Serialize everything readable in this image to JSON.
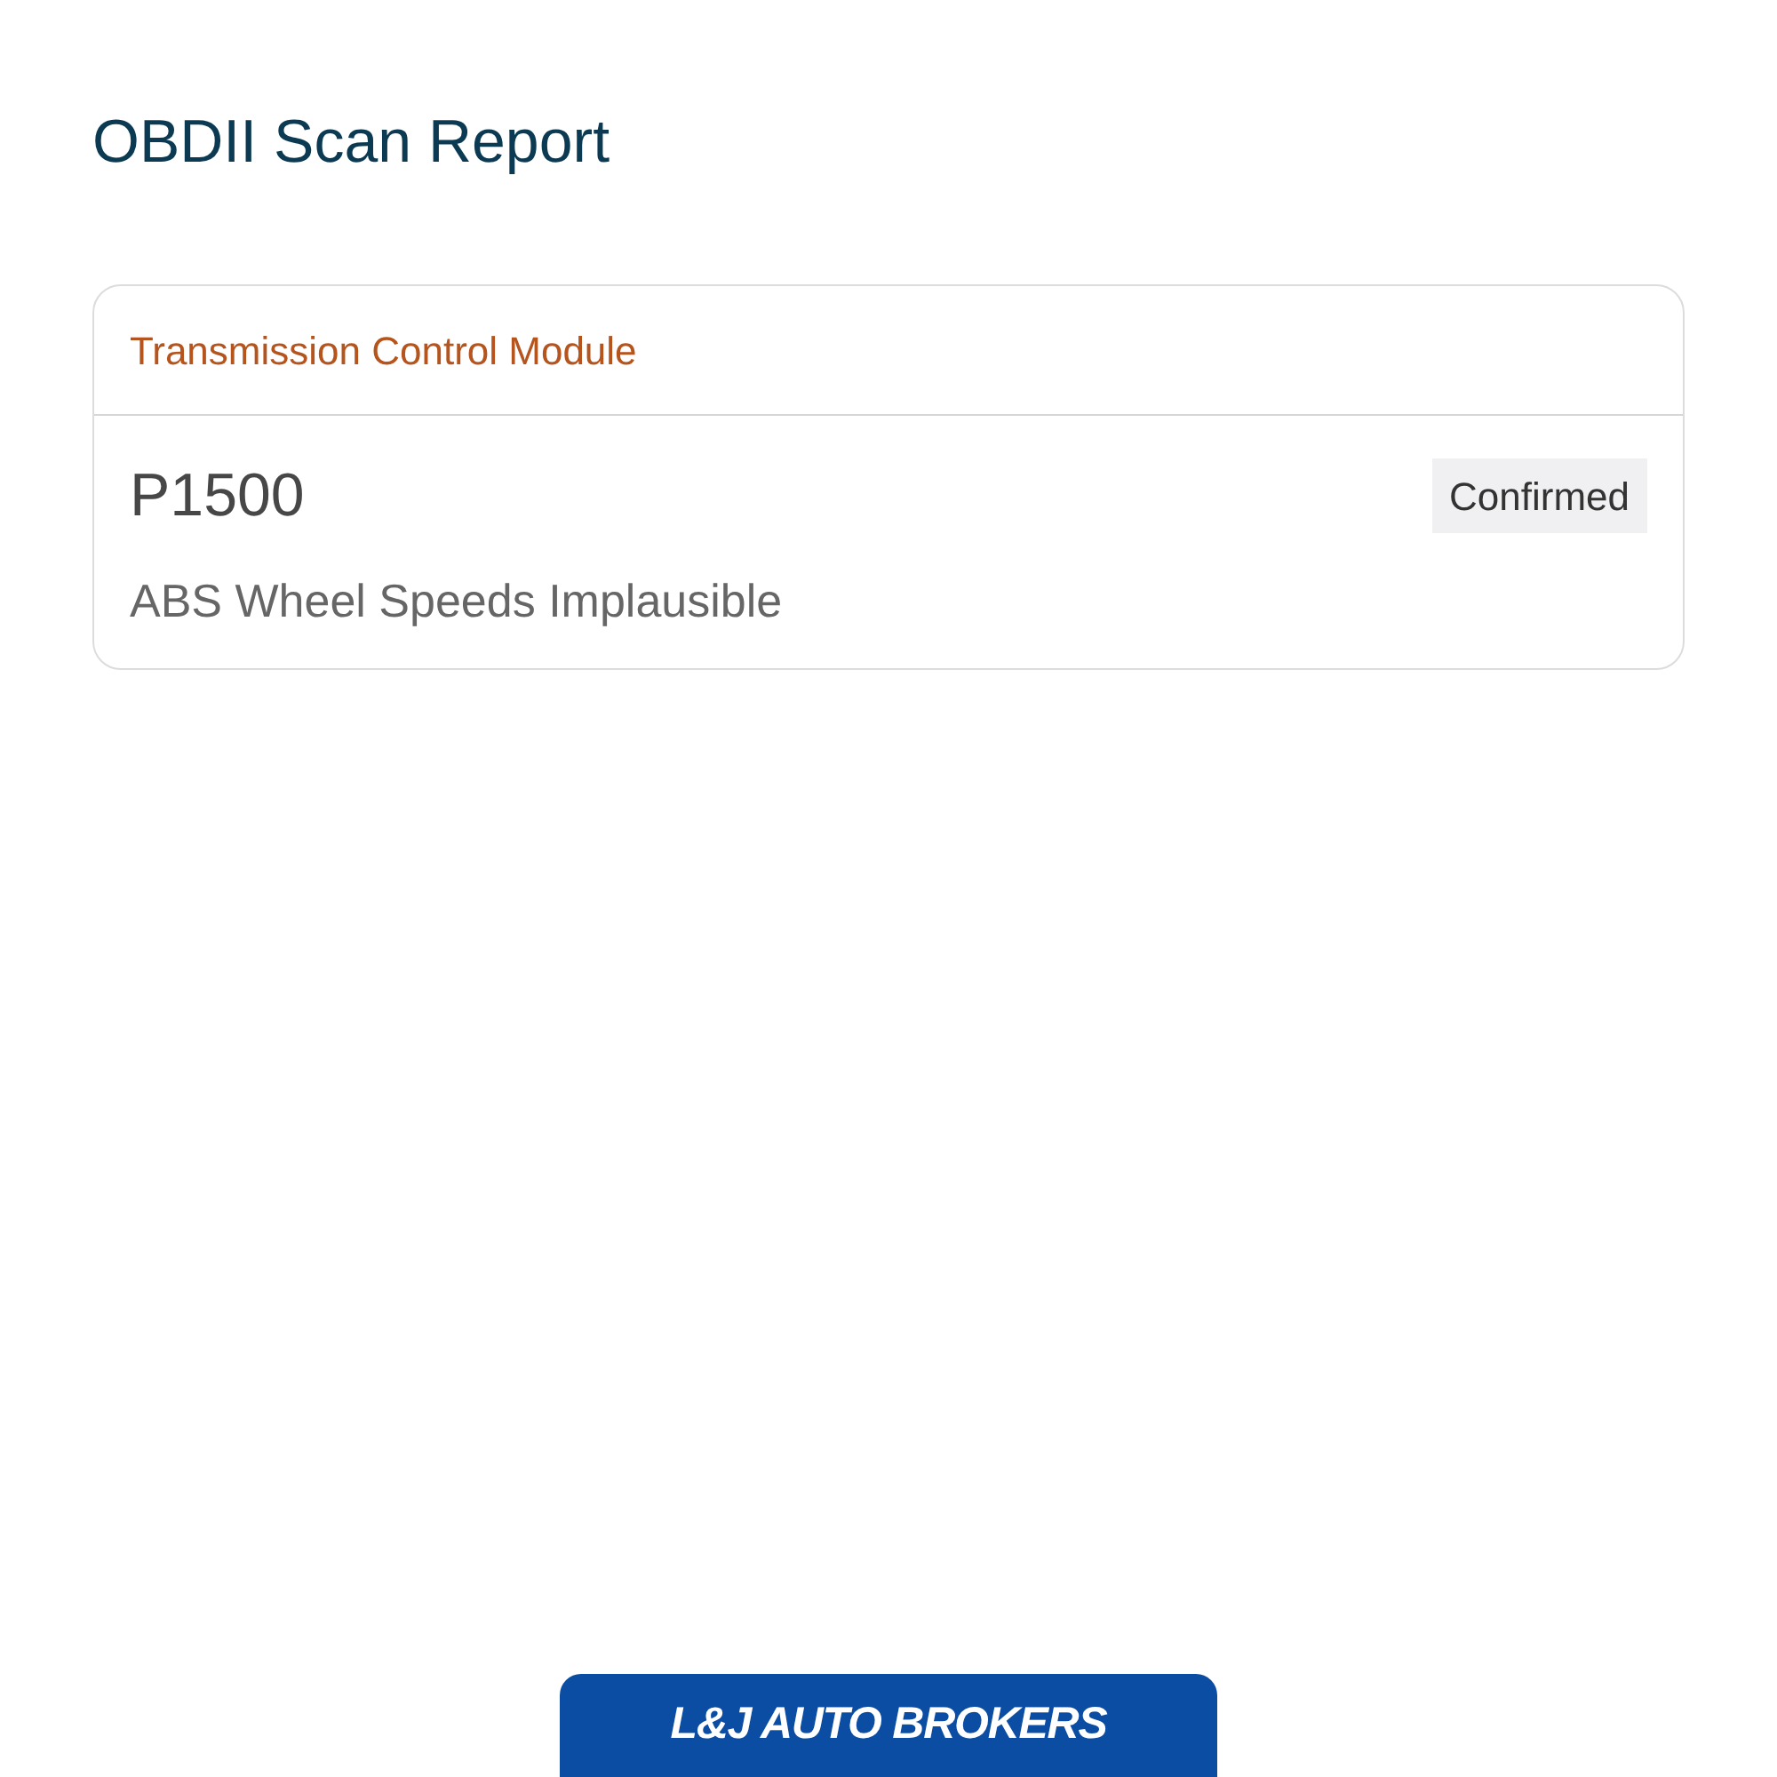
{
  "title": "OBDII Scan Report",
  "modules": [
    {
      "name": "Transmission Control Module",
      "codes": [
        {
          "code": "P1500",
          "status": "Confirmed",
          "description": "ABS Wheel Speeds Implausible"
        }
      ]
    }
  ],
  "footer": {
    "logo_text": "L&J AUTO BROKERS"
  }
}
